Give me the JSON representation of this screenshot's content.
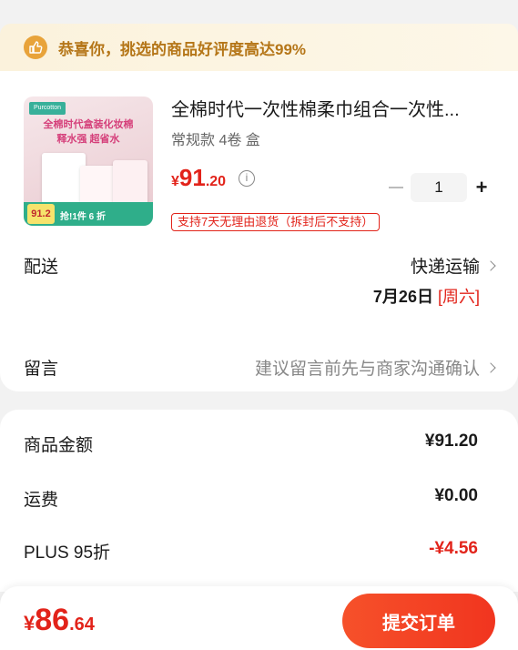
{
  "banner": {
    "text": "恭喜你，挑选的商品好评度高达99%",
    "icon": "thumbs-up-icon",
    "color": "#e8a33a"
  },
  "product": {
    "title": "全棉时代一次性棉柔巾组合一次性...",
    "spec": "常规款 4卷 盒",
    "price_currency": "¥",
    "price_int": "91",
    "price_dec": ".20",
    "quantity": "1",
    "return_policy": "支持7天无理由退货（拆封后不支持）",
    "image": {
      "brand": "Purcotton",
      "line1": "全棉时代盒装化妆棉",
      "line2": "释水强 超省水",
      "badge_price": "91.2",
      "strip_text": "抢!1件 6 折"
    }
  },
  "delivery": {
    "label": "配送",
    "method": "快递运输",
    "date": "7月26日",
    "weekday": "[周六]"
  },
  "note": {
    "label": "留言",
    "placeholder": "建议留言前先与商家沟通确认"
  },
  "summary": {
    "items": [
      {
        "label": "商品金额",
        "value": "¥91.20"
      },
      {
        "label": "运费",
        "value": "¥0.00"
      },
      {
        "label": "PLUS 95折",
        "value": "-¥4.56"
      }
    ]
  },
  "footer": {
    "total_currency": "¥",
    "total_int": "86",
    "total_dec": ".64",
    "submit_label": "提交订单"
  },
  "colors": {
    "accent": "#e2231a",
    "banner_text": "#b57618",
    "submit": "#f1351f"
  }
}
